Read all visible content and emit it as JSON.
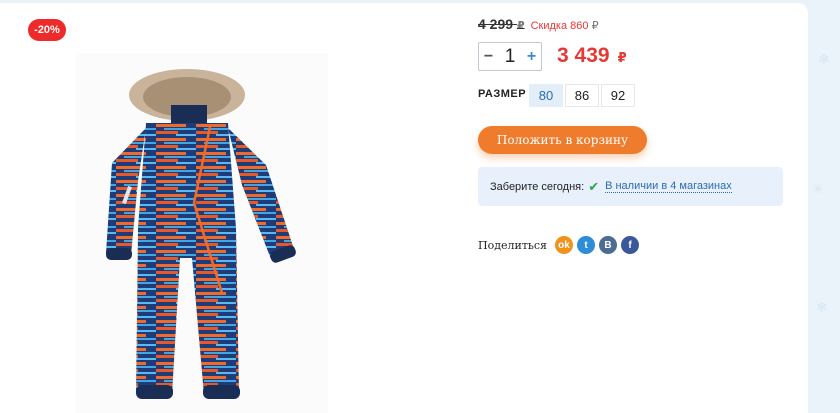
{
  "badge": "-20%",
  "product_image": "kids-winter-overall",
  "price": {
    "old": "4 299",
    "old_currency": "₽",
    "discount": "Скидка 860",
    "discount_currency": "₽",
    "current": "3 439",
    "currency": "₽"
  },
  "quantity": {
    "minus": "−",
    "value": "1",
    "plus": "+"
  },
  "size": {
    "label": "РАЗМЕР",
    "options": [
      "80",
      "86",
      "92"
    ],
    "selected": "80"
  },
  "cart_button": "Положить в корзину",
  "pickup": {
    "label": "Заберите сегодня:",
    "check": "✔",
    "link": "В наличии в 4 магазинах"
  },
  "share": {
    "label": "Поделиться",
    "networks": [
      {
        "name": "odnoklassniki",
        "glyph": "ok"
      },
      {
        "name": "twitter",
        "glyph": "t"
      },
      {
        "name": "vkontakte",
        "glyph": "B"
      },
      {
        "name": "facebook",
        "glyph": "f"
      }
    ]
  },
  "colors": {
    "accent_orange": "#ef7c2c",
    "price_red": "#e53935",
    "link_blue": "#2a6cb0",
    "background": "#eaf3fa"
  }
}
